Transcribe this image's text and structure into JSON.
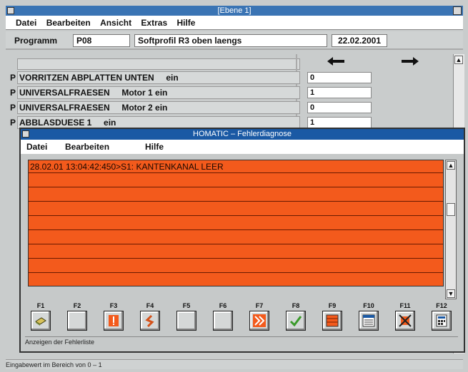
{
  "window": {
    "title": "[Ebene 1]"
  },
  "menu": [
    "Datei",
    "Bearbeiten",
    "Ansicht",
    "Extras",
    "Hilfe"
  ],
  "header": {
    "label": "Programm",
    "program_id": "P08",
    "program_name": "Softprofil R3 oben laengs",
    "date": "22.02.2001"
  },
  "params": [
    {
      "flag": "P",
      "text": "VORRITZEN ABPLATTEN UNTEN     ein",
      "value": "0"
    },
    {
      "flag": "P",
      "text": "UNIVERSALFRAESEN     Motor 1 ein",
      "value": "1"
    },
    {
      "flag": "P",
      "text": "UNIVERSALFRAESEN     Motor 2 ein",
      "value": "0"
    },
    {
      "flag": "P",
      "text": "ABBLASDUESE 1     ein",
      "value": "1"
    }
  ],
  "dialog": {
    "title": "HOMATIC – Fehlerdiagnose",
    "menu": [
      "Datei",
      "Bearbeiten",
      "Hilfe"
    ],
    "errors": [
      "28.02.01 13:04:42:450>S1: KANTENKANAL LEER"
    ],
    "fkeys": [
      {
        "label": "F1",
        "icon": "book-icon"
      },
      {
        "label": "F2",
        "icon": ""
      },
      {
        "label": "F3",
        "icon": "exclamation-icon"
      },
      {
        "label": "F4",
        "icon": "zigzag-icon"
      },
      {
        "label": "F5",
        "icon": ""
      },
      {
        "label": "F6",
        "icon": ""
      },
      {
        "label": "F7",
        "icon": "double-chevron-right-icon"
      },
      {
        "label": "F8",
        "icon": "checkmark-icon"
      },
      {
        "label": "F9",
        "icon": "grid-icon"
      },
      {
        "label": "F10",
        "icon": "window-list-icon"
      },
      {
        "label": "F11",
        "icon": "cancel-icon"
      },
      {
        "label": "F12",
        "icon": "calculator-icon"
      }
    ],
    "status": "Anzeigen der Fehlerliste"
  },
  "status": "Eingabewert im Bereich von 0 – 1",
  "colors": {
    "error_bg": "#f35a1c",
    "title_bar": "#1a59a4",
    "main_title_bar": "#3a74b4"
  }
}
